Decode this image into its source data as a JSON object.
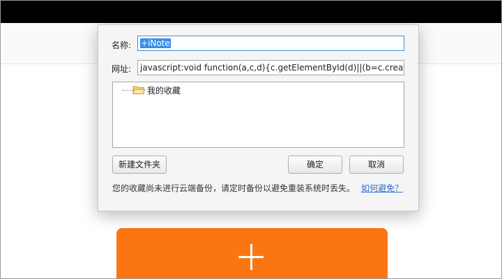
{
  "dialog": {
    "name_label": "名称:",
    "name_value": "+iNote",
    "url_label": "网址:",
    "url_value": "javascript:void function(a,c,d){c.getElementById(d)||(b=c.createEle",
    "tree_item": "我的收藏",
    "new_folder_button": "新建文件夹",
    "ok_button": "确定",
    "cancel_button": "取消",
    "tip_text": "您的收藏尚未进行云端备份，请定时备份以避免重装系统时丢失。",
    "tip_link": "如何避免？"
  },
  "colors": {
    "accent_tile": "#fb7613",
    "selection": "#3a8ee6",
    "link": "#2f6fc6"
  },
  "icons": {
    "folder": "folder-icon",
    "plus": "plus-icon"
  }
}
